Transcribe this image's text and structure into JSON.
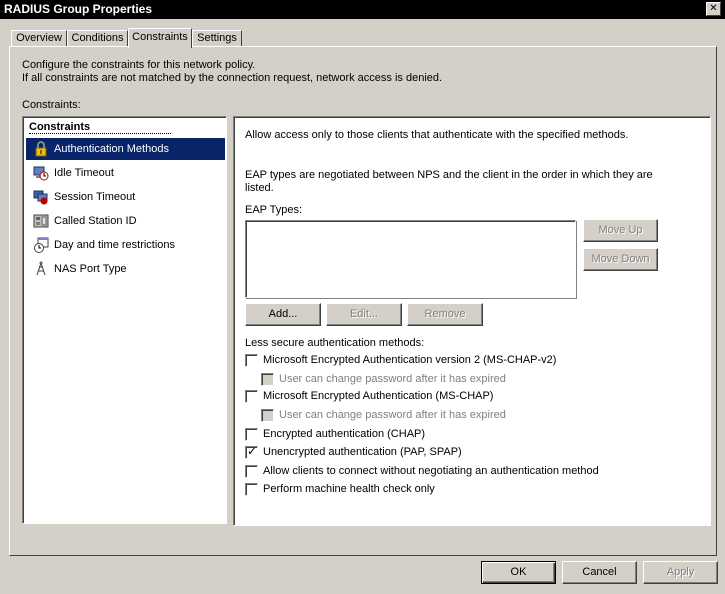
{
  "window": {
    "title": "RADIUS Group Properties",
    "close_glyph": "✕"
  },
  "tabs": [
    {
      "label": "Overview"
    },
    {
      "label": "Conditions"
    },
    {
      "label": "Constraints"
    },
    {
      "label": "Settings"
    }
  ],
  "description": {
    "line1": "Configure the constraints for this network policy.",
    "line2": "If all constraints are not matched by the connection request, network access is denied."
  },
  "constraints_label": "Constraints:",
  "list": {
    "header": "Constraints",
    "items": [
      {
        "label": "Authentication Methods",
        "icon": "lock-icon"
      },
      {
        "label": "Idle Timeout",
        "icon": "idle-timeout-icon"
      },
      {
        "label": "Session Timeout",
        "icon": "session-timeout-icon"
      },
      {
        "label": "Called Station ID",
        "icon": "phone-icon"
      },
      {
        "label": "Day and time restrictions",
        "icon": "calendar-clock-icon"
      },
      {
        "label": "NAS Port Type",
        "icon": "network-port-icon"
      }
    ]
  },
  "detail": {
    "intro": "Allow access only to those clients that authenticate with the specified methods.",
    "eap_desc_line1": "EAP types are negotiated between NPS and the client in the order in which they are",
    "eap_desc_line2": "listed.",
    "eap_types_label": "EAP Types:",
    "move_up": "Move Up",
    "move_down": "Move Down",
    "add": "Add...",
    "edit": "Edit...",
    "remove": "Remove",
    "less_secure_label": "Less secure authentication methods:",
    "options": [
      {
        "label": "Microsoft Encrypted Authentication version 2 (MS-CHAP-v2)",
        "checked": false,
        "disabled": false
      },
      {
        "label": "User can change password after it has expired",
        "checked": false,
        "disabled": true
      },
      {
        "label": "Microsoft Encrypted Authentication (MS-CHAP)",
        "checked": false,
        "disabled": false
      },
      {
        "label": "User can change password after it has expired",
        "checked": false,
        "disabled": true
      },
      {
        "label": "Encrypted authentication (CHAP)",
        "checked": false,
        "disabled": false
      },
      {
        "label": "Unencrypted authentication (PAP, SPAP)",
        "checked": true,
        "disabled": false
      },
      {
        "label": "Allow clients to connect without negotiating an authentication method",
        "checked": false,
        "disabled": false
      },
      {
        "label": "Perform machine health check only",
        "checked": false,
        "disabled": false
      }
    ],
    "check_glyph": "✓"
  },
  "footer": {
    "ok": "OK",
    "cancel": "Cancel",
    "apply": "Apply"
  },
  "colors": {
    "selection": "#0a246a",
    "face": "#d4d0c8"
  }
}
